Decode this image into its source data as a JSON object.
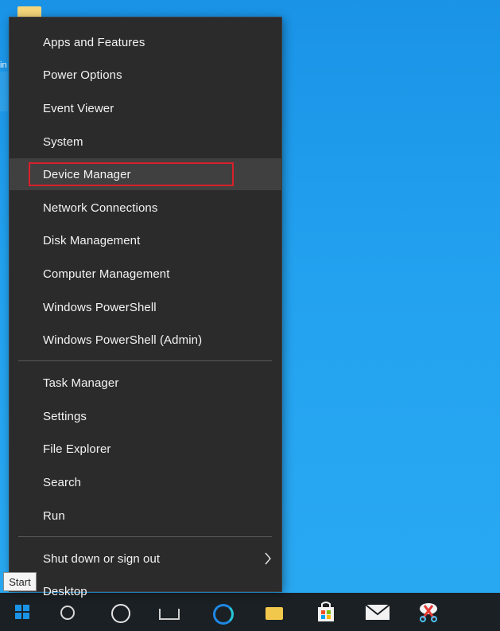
{
  "desktop": {
    "left_edge_text": "in"
  },
  "tooltip": {
    "start": "Start"
  },
  "menu": {
    "items_group1": [
      {
        "label": "Apps and Features",
        "name": "menu-item-apps-and-features"
      },
      {
        "label": "Power Options",
        "name": "menu-item-power-options"
      },
      {
        "label": "Event Viewer",
        "name": "menu-item-event-viewer"
      },
      {
        "label": "System",
        "name": "menu-item-system"
      },
      {
        "label": "Device Manager",
        "name": "menu-item-device-manager",
        "highlighted": true
      },
      {
        "label": "Network Connections",
        "name": "menu-item-network-connections"
      },
      {
        "label": "Disk Management",
        "name": "menu-item-disk-management"
      },
      {
        "label": "Computer Management",
        "name": "menu-item-computer-management"
      },
      {
        "label": "Windows PowerShell",
        "name": "menu-item-windows-powershell"
      },
      {
        "label": "Windows PowerShell (Admin)",
        "name": "menu-item-windows-powershell-admin"
      }
    ],
    "items_group2": [
      {
        "label": "Task Manager",
        "name": "menu-item-task-manager"
      },
      {
        "label": "Settings",
        "name": "menu-item-settings"
      },
      {
        "label": "File Explorer",
        "name": "menu-item-file-explorer"
      },
      {
        "label": "Search",
        "name": "menu-item-search"
      },
      {
        "label": "Run",
        "name": "menu-item-run"
      }
    ],
    "items_group3": [
      {
        "label": "Shut down or sign out",
        "name": "menu-item-shut-down-or-sign-out",
        "submenu": true
      },
      {
        "label": "Desktop",
        "name": "menu-item-desktop"
      }
    ]
  },
  "taskbar": {
    "icons": [
      "windows-start-icon",
      "search-icon",
      "task-view-icon",
      "people-icon",
      "edge-icon",
      "file-explorer-icon",
      "store-icon",
      "mail-icon",
      "snip-sketch-icon"
    ]
  },
  "colors": {
    "desktop_blue": "#1a93e6",
    "menu_bg": "#2b2b2b",
    "menu_hover": "#404040",
    "highlight_red": "#d91f2a",
    "taskbar_bg": "#1b2024"
  }
}
